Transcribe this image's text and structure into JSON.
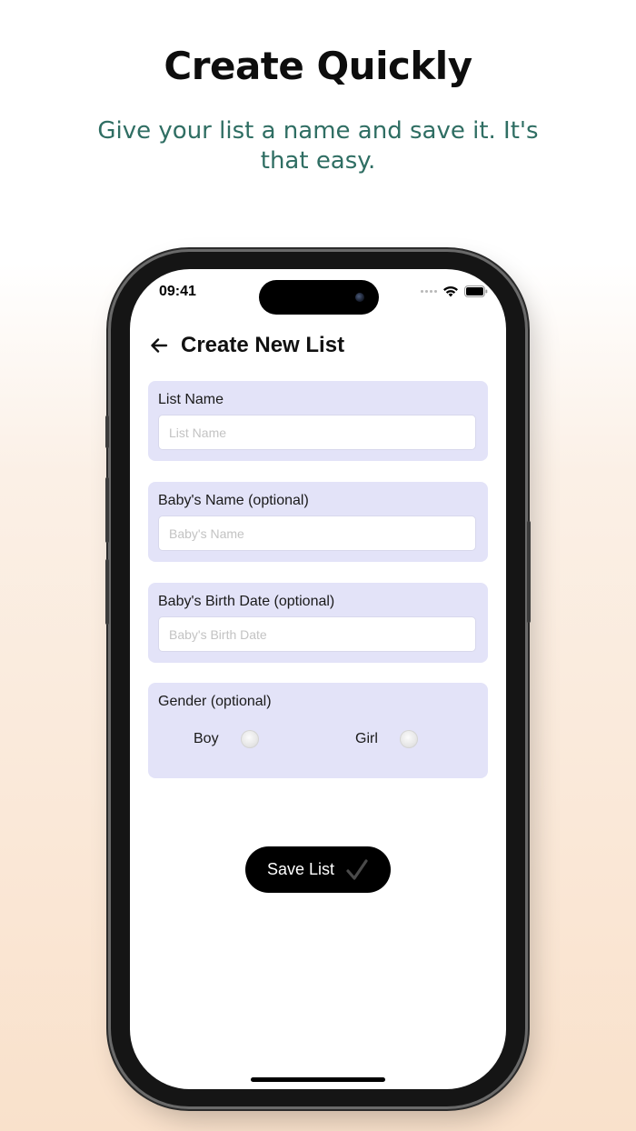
{
  "promo": {
    "title": "Create Quickly",
    "subtitle": "Give your list a name and save it. It's that easy."
  },
  "status_bar": {
    "time": "09:41"
  },
  "nav": {
    "title": "Create New List"
  },
  "form": {
    "list_name": {
      "label": "List Name",
      "placeholder": "List Name",
      "value": ""
    },
    "baby_name": {
      "label": "Baby's Name (optional)",
      "placeholder": "Baby's Name",
      "value": ""
    },
    "birth_date": {
      "label": "Baby's Birth Date (optional)",
      "placeholder": "Baby's Birth Date",
      "value": ""
    },
    "gender": {
      "label": "Gender (optional)",
      "options": [
        "Boy",
        "Girl"
      ],
      "selected": null
    }
  },
  "save_button": {
    "label": "Save List"
  },
  "colors": {
    "subtitle_green": "#2f6e63",
    "card_lavender": "#e3e3f8",
    "button_black": "#000000"
  },
  "icons": [
    "back-arrow-icon",
    "checkmark-icon",
    "wifi-icon",
    "battery-icon",
    "cellular-signal-icon"
  ]
}
